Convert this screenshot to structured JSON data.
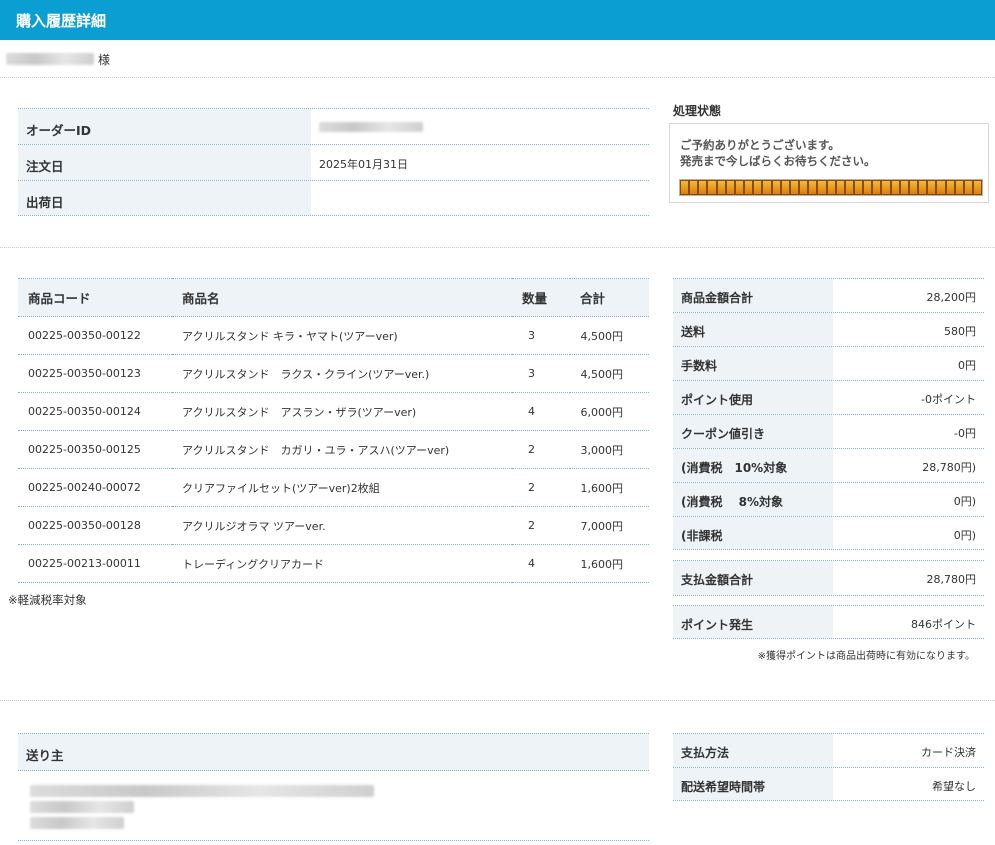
{
  "header": {
    "title": "購入履歴詳細"
  },
  "customer": {
    "honorific": "様"
  },
  "order_info": [
    {
      "label": "オーダーID",
      "value": ""
    },
    {
      "label": "注文日",
      "value": "2025年01月31日"
    },
    {
      "label": "出荷日",
      "value": ""
    }
  ],
  "status": {
    "title": "処理状態",
    "message_line1": "ご予約ありがとうございます。",
    "message_line2": "発売まで今しばらくお待ちください。",
    "progress": 1.0
  },
  "items": {
    "headers": {
      "code": "商品コード",
      "name": "商品名",
      "qty": "数量",
      "total": "合計"
    },
    "rows": [
      {
        "code": "00225-00350-00122",
        "name": "アクリルスタンド キラ・ヤマト(ツアーver)",
        "qty": "3",
        "total": "4,500円"
      },
      {
        "code": "00225-00350-00123",
        "name": "アクリルスタンド　ラクス・クライン(ツアーver.)",
        "qty": "3",
        "total": "4,500円"
      },
      {
        "code": "00225-00350-00124",
        "name": "アクリルスタンド　アスラン・ザラ(ツアーver)",
        "qty": "4",
        "total": "6,000円"
      },
      {
        "code": "00225-00350-00125",
        "name": "アクリルスタンド　カガリ・ユラ・アスハ(ツアーver)",
        "qty": "2",
        "total": "3,000円"
      },
      {
        "code": "00225-00240-00072",
        "name": "クリアファイルセット(ツアーver)2枚組",
        "qty": "2",
        "total": "1,600円"
      },
      {
        "code": "00225-00350-00128",
        "name": "アクリルジオラマ ツアーver.",
        "qty": "2",
        "total": "7,000円"
      },
      {
        "code": "00225-00213-00011",
        "name": "トレーディングクリアカード",
        "qty": "4",
        "total": "1,600円"
      }
    ],
    "note": "※軽減税率対象"
  },
  "summary": [
    {
      "label": "商品金額合計",
      "value": "28,200円"
    },
    {
      "label": "送料",
      "value": "580円"
    },
    {
      "label": "手数料",
      "value": "0円"
    },
    {
      "label": "ポイント使用",
      "value": "-0ポイント"
    },
    {
      "label": "クーポン値引き",
      "value": "-0円"
    },
    {
      "label": "(消費税　10%対象",
      "value": "28,780円)"
    },
    {
      "label": "(消費税　 8%対象",
      "value": "0円)"
    },
    {
      "label": "(非課税",
      "value": "0円)"
    }
  ],
  "payment_total": {
    "label": "支払金額合計",
    "value": "28,780円"
  },
  "points_earned": {
    "label": "ポイント発生",
    "value": "846ポイント",
    "note": "※獲得ポイントは商品出荷時に有効になります。"
  },
  "sender": {
    "label": "送り主"
  },
  "shipping": [
    {
      "label": "支払方法",
      "value": "カード決済"
    },
    {
      "label": "配送希望時間帯",
      "value": "希望なし"
    }
  ]
}
